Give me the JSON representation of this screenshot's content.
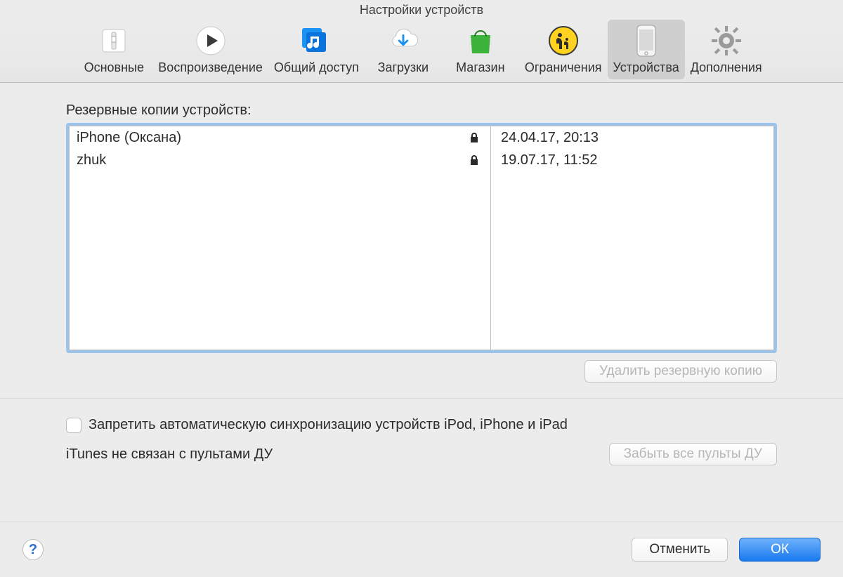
{
  "window": {
    "title": "Настройки устройств"
  },
  "toolbar": {
    "items": [
      {
        "label": "Основные"
      },
      {
        "label": "Воспроизведение"
      },
      {
        "label": "Общий доступ"
      },
      {
        "label": "Загрузки"
      },
      {
        "label": "Магазин"
      },
      {
        "label": "Ограничения"
      },
      {
        "label": "Устройства"
      },
      {
        "label": "Дополнения"
      }
    ]
  },
  "backups": {
    "heading": "Резервные копии устройств:",
    "rows": [
      {
        "name": "iPhone (Оксана)",
        "locked": true,
        "date": "24.04.17, 20:13"
      },
      {
        "name": "zhuk",
        "locked": true,
        "date": "19.07.17, 11:52"
      }
    ],
    "delete_button": "Удалить резервную копию"
  },
  "sync": {
    "checkbox_label": "Запретить автоматическую синхронизацию устройств iPod, iPhone и iPad",
    "remotes_status": "iTunes не связан с пультами ДУ",
    "forget_button": "Забыть все пульты ДУ"
  },
  "footer": {
    "help_glyph": "?",
    "cancel": "Отменить",
    "ok": "ОК"
  }
}
